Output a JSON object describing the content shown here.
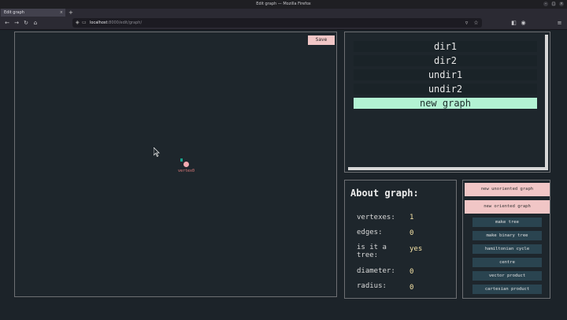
{
  "window": {
    "title": "Edit graph — Mozilla Firefox"
  },
  "browser": {
    "tab_title": "Edit graph",
    "tab_close": "×",
    "new_tab": "+",
    "url_host": "localhost",
    "url_path": ":8000/edit/graph/",
    "back": "←",
    "forward": "→",
    "reload": "↻",
    "home": "⌂"
  },
  "editor": {
    "save_label": "Save",
    "vertex_label": "vertex0",
    "vertex_color": "#f3aab0",
    "vertex_handle_color": "#18a089"
  },
  "graphs": {
    "items": [
      {
        "label": "dir1"
      },
      {
        "label": "dir2"
      },
      {
        "label": "undir1"
      },
      {
        "label": "undir2"
      },
      {
        "label": "new graph",
        "active": true
      }
    ]
  },
  "about": {
    "title": "About graph:",
    "rows": [
      {
        "key": "vertexes:",
        "value": "1"
      },
      {
        "key": "edges:",
        "value": "0"
      },
      {
        "key": "is it a tree:",
        "value": "yes"
      },
      {
        "key": "diameter:",
        "value": "0"
      },
      {
        "key": "radius:",
        "value": "0"
      }
    ]
  },
  "actions": {
    "new_unoriented": "new unoriented graph",
    "new_oriented": "new oriented graph",
    "buttons": [
      "make tree",
      "make binary tree",
      "hamiltonian cycle",
      "centre",
      "vector product",
      "cartesian product"
    ]
  },
  "colors": {
    "accent_pink": "#f1c6c6",
    "active_green": "#b3f3d3",
    "button_teal": "#2a4450",
    "value_yellow": "#f6e3a6"
  }
}
